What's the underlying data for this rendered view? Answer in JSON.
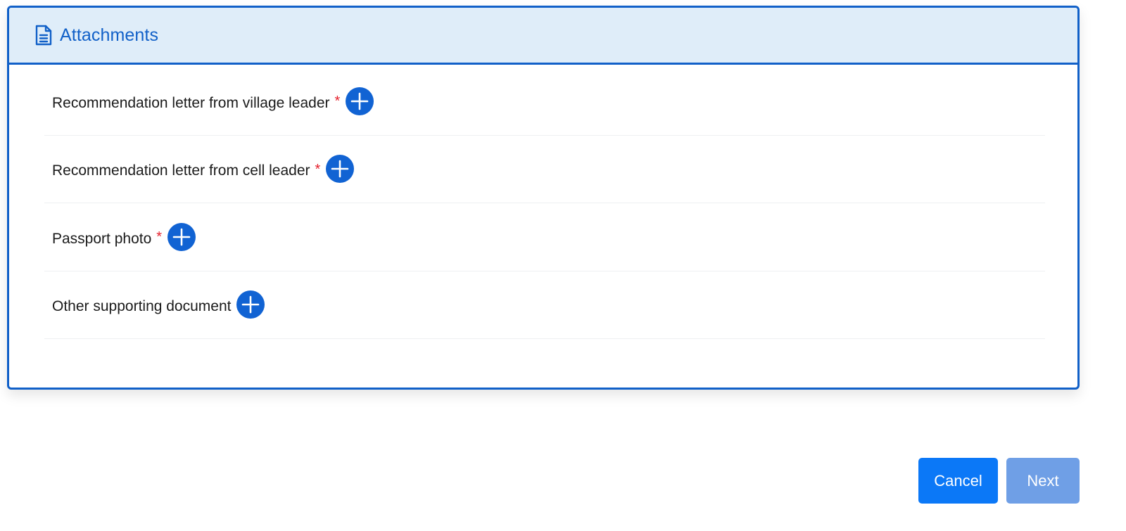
{
  "card": {
    "icon": "document-icon",
    "title": "Attachments"
  },
  "attachments": [
    {
      "label": "Recommendation letter from village leader",
      "required": true,
      "required_mark": "*"
    },
    {
      "label": "Recommendation letter from cell leader",
      "required": true,
      "required_mark": "*"
    },
    {
      "label": "Passport photo",
      "required": true,
      "required_mark": "*"
    },
    {
      "label": "Other supporting document",
      "required": false
    }
  ],
  "add_icon": "plus-circle-icon",
  "actions": {
    "cancel_label": "Cancel",
    "next_label": "Next"
  },
  "colors": {
    "accent": "#1160c8",
    "header_bg": "#dfedf9",
    "required": "#e5212d",
    "cancel_bg": "#0b78f7",
    "next_bg": "#6f9fe6"
  }
}
